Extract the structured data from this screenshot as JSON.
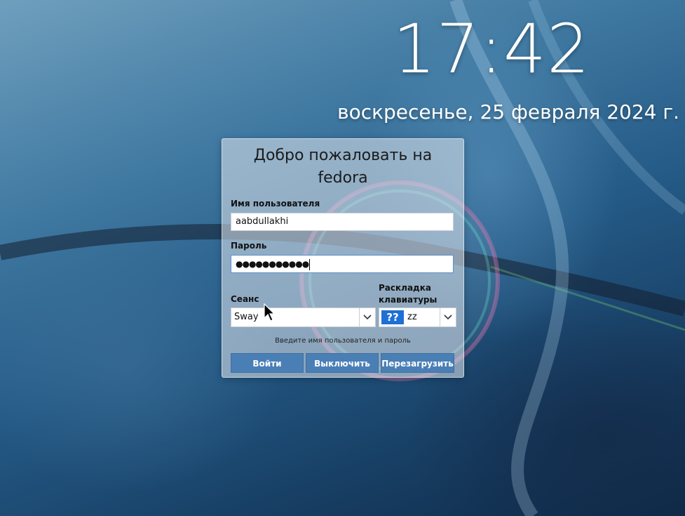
{
  "lockscreen": {
    "time": "17:42",
    "date": "воскресенье, 25 февраля 2024 г."
  },
  "login": {
    "welcome_line1": "Добро пожаловать на",
    "welcome_line2": "fedora",
    "username_label": "Имя пользователя",
    "username_value": "aabdullakhi",
    "password_label": "Пароль",
    "password_masked": "●●●●●●●●●●●",
    "session_label": "Сеанс",
    "session_value": "Sway",
    "keyboard_label_line1": "Раскладка",
    "keyboard_label_line2": "клавиатуры",
    "keyboard_flag": "??",
    "keyboard_value": "zz",
    "hint": "Введите имя пользователя и пароль",
    "buttons": {
      "login": "Войти",
      "shutdown": "Выключить",
      "reboot": "Перезагрузить"
    }
  },
  "colors": {
    "button_bg": "#4a7fb6",
    "flag_bg": "#1f6fd6"
  },
  "icons": {
    "session_dropdown": "chevron-down-icon",
    "keyboard_dropdown": "chevron-down-icon",
    "pointer": "mouse-pointer-icon"
  }
}
